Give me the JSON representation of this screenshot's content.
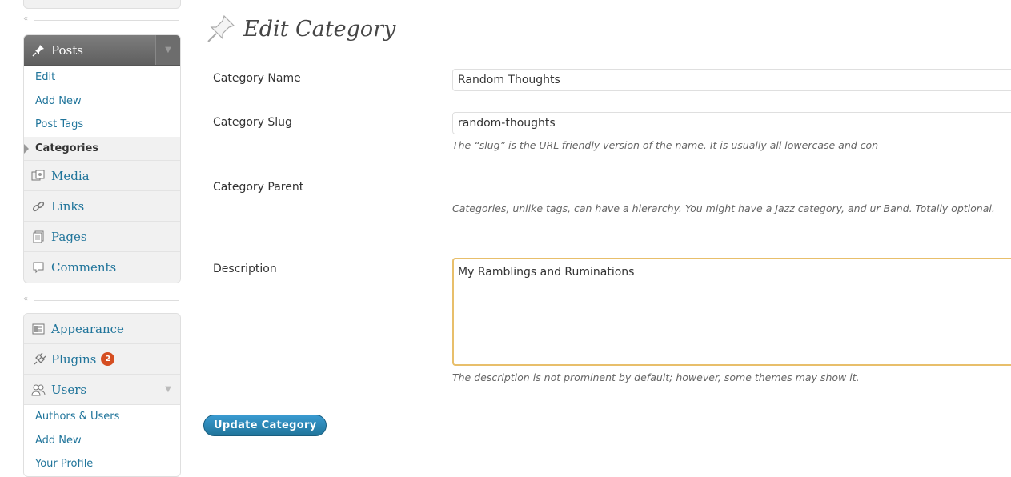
{
  "sidebar": {
    "posts": {
      "label": "Posts",
      "icon": "pushpin-icon",
      "submenu": [
        "Edit",
        "Add New",
        "Post Tags",
        "Categories"
      ]
    },
    "media": {
      "label": "Media",
      "icon": "media-icon"
    },
    "links": {
      "label": "Links",
      "icon": "link-icon"
    },
    "pages": {
      "label": "Pages",
      "icon": "pages-icon"
    },
    "comments": {
      "label": "Comments",
      "icon": "comment-icon"
    },
    "appearance": {
      "label": "Appearance",
      "icon": "appearance-icon"
    },
    "plugins": {
      "label": "Plugins",
      "icon": "plugin-icon",
      "badge": "2"
    },
    "users": {
      "label": "Users",
      "icon": "users-icon",
      "submenu": [
        "Authors & Users",
        "Add New",
        "Your Profile"
      ]
    }
  },
  "page": {
    "title": "Edit Category",
    "fields": {
      "name_label": "Category Name",
      "name_value": "Random Thoughts",
      "slug_label": "Category Slug",
      "slug_value": "random-thoughts",
      "slug_help": "The “slug” is the URL-friendly version of the name. It is usually all lowercase and con",
      "parent_label": "Category Parent",
      "parent_help": "Categories, unlike tags, can have a hierarchy. You might have a Jazz category, and ur Band. Totally optional.",
      "description_label": "Description",
      "description_value": "My Ramblings and Ruminations",
      "description_help": "The description is not prominent by default; however, some themes may show it."
    },
    "submit_label": "Update Category"
  },
  "colors": {
    "link": "#21759b",
    "current_menu_bg": "#6d6d6d",
    "badge": "#d54e21",
    "textarea_focus_border": "#e8bf6b",
    "button_primary": "#21759b"
  }
}
